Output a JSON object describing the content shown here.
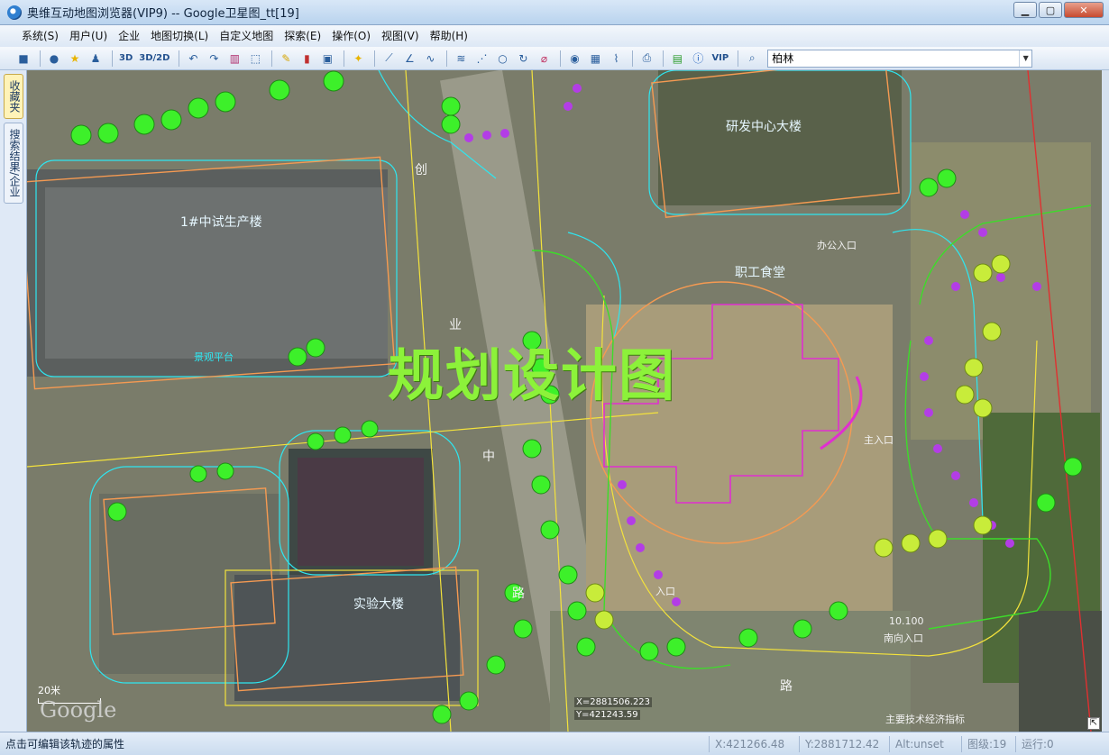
{
  "window": {
    "title": "奥维互动地图浏览器(VIP9) -- Google卫星图_tt[19]",
    "minimize": "▁",
    "maximize": "▢",
    "close": "✕"
  },
  "menu": [
    "系统(S)",
    "用户(U)",
    "企业",
    "地图切换(L)",
    "自定义地图",
    "探索(E)",
    "操作(O)",
    "视图(V)",
    "帮助(H)"
  ],
  "toolbar": {
    "text_3d": "3D",
    "text_3d2d": "3D/2D",
    "text_vip": "VIP",
    "search_value": "柏林",
    "icons": [
      "save-icon",
      "user-icon",
      "star-icon",
      "group-icon",
      "undo-icon",
      "redo-icon",
      "delete-icon",
      "layers-icon",
      "pin-icon",
      "line-icon",
      "circle-icon",
      "measure-icon",
      "chat-icon",
      "info-icon",
      "search-icon"
    ]
  },
  "sidebar": {
    "tabs": [
      "收藏夹",
      "搜索结果/企业"
    ]
  },
  "map": {
    "watermark": "规划设计图",
    "labels": {
      "building1": "1#中试生产楼",
      "rd_center": "研发中心大楼",
      "canteen": "职工食堂",
      "lab": "实验大楼",
      "road_chuang": "创",
      "road_ye": "业",
      "road_zhong": "中",
      "road_lu": "路",
      "road_lu2": "路",
      "entrance_s": "南向入口",
      "main_entrance": "主入口",
      "office_entrance": "办公入口",
      "entrance": "入口",
      "elevation": "10.100",
      "tech_table": "主要技术经济指标",
      "landscape": "景观平台"
    },
    "coord_x": "X=2881506.223",
    "coord_y": "Y=421243.59",
    "scale": "20米",
    "logo": "Google",
    "resize": "⇱"
  },
  "status": {
    "message": "点击可编辑该轨迹的属性",
    "x": "X:421266.48",
    "y": "Y:2881712.42",
    "alt": "Alt:unset",
    "level": "图级:19",
    "running": "运行:0"
  },
  "colors": {
    "cad_cyan": "#2ee6f0",
    "cad_yellow": "#f3e23c",
    "cad_magenta": "#e02fd0",
    "cad_orange": "#f59a52",
    "tree_green": "#3df02a",
    "watermark": "#8cf23a"
  }
}
